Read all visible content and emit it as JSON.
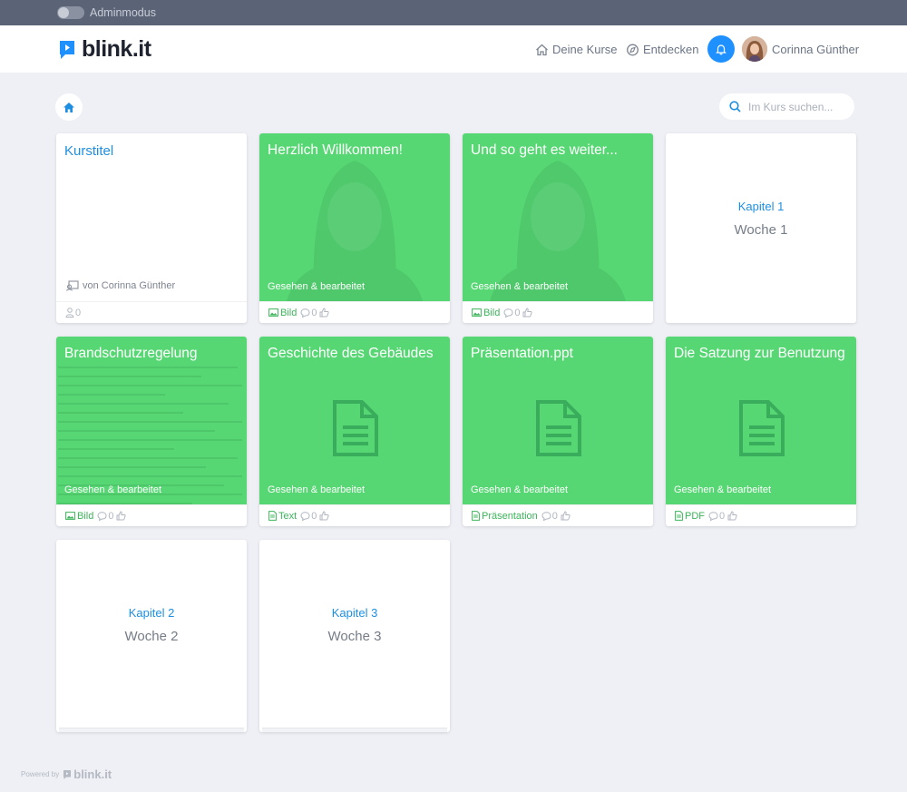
{
  "adminbar": {
    "label": "Adminmodus"
  },
  "header": {
    "logo": "blink.it",
    "nav": {
      "courses": "Deine Kurse",
      "discover": "Entdecken"
    },
    "user": "Corinna Günther"
  },
  "search": {
    "placeholder": "Im Kurs suchen..."
  },
  "course": {
    "title": "Kurstitel",
    "author": "von Corinna Günther",
    "count": "0"
  },
  "cards": [
    {
      "title": "Herzlich Willkommen!",
      "status": "Gesehen & bearbeitet",
      "type": "Bild",
      "comments": "0"
    },
    {
      "title": "Und so geht es weiter...",
      "status": "Gesehen & bearbeitet",
      "type": "Bild",
      "comments": "0"
    },
    {
      "title": "Brandschutzregelung",
      "status": "Gesehen & bearbeitet",
      "type": "Bild",
      "comments": "0"
    },
    {
      "title": "Geschichte des Gebäudes",
      "status": "Gesehen & bearbeitet",
      "type": "Text",
      "comments": "0"
    },
    {
      "title": "Präsentation.ppt",
      "status": "Gesehen & bearbeitet",
      "type": "Präsentation",
      "comments": "0"
    },
    {
      "title": "Die Satzung zur Benutzung",
      "status": "Gesehen & bearbeitet",
      "type": "PDF",
      "comments": "0"
    }
  ],
  "chapters": [
    {
      "label": "Kapitel 1",
      "week": "Woche 1"
    },
    {
      "label": "Kapitel 2",
      "week": "Woche 2"
    },
    {
      "label": "Kapitel 3",
      "week": "Woche 3"
    }
  ],
  "footer": {
    "powered": "Powered by",
    "brand": "blink.it"
  },
  "colors": {
    "accent": "#1e90ff",
    "card_green": "#57d774",
    "adminbar": "#5b6477"
  }
}
